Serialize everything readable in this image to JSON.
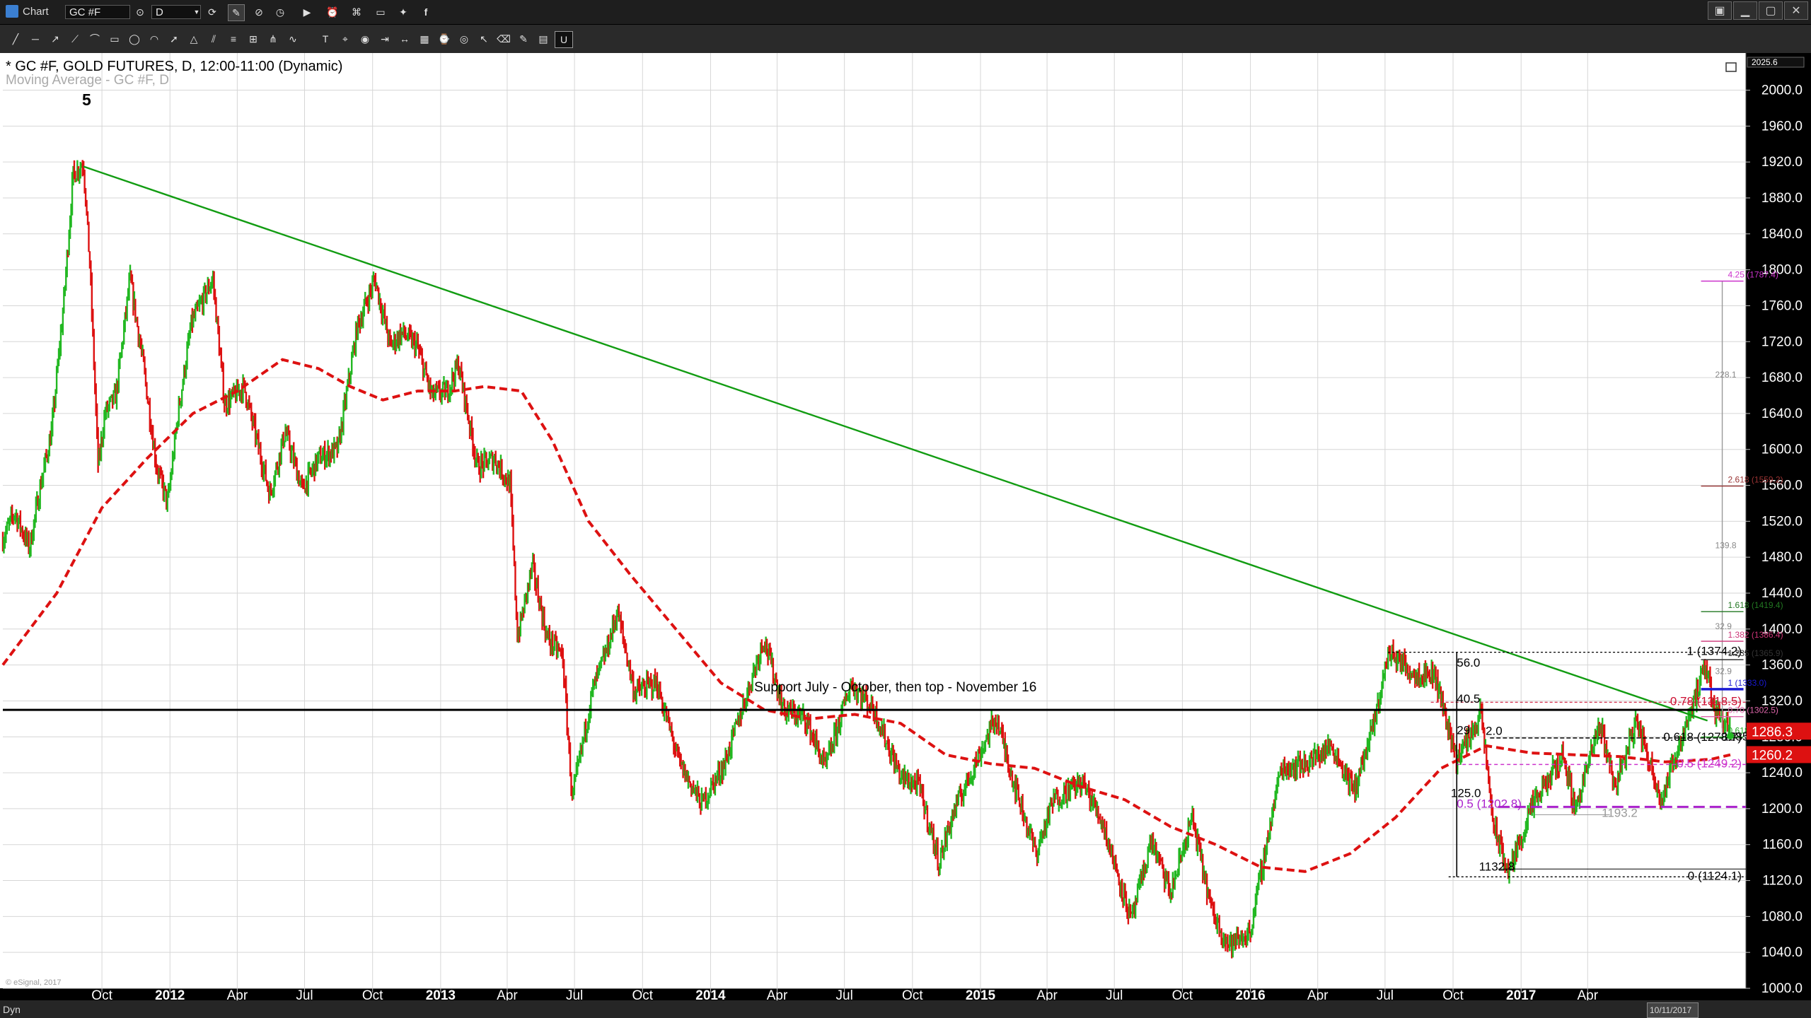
{
  "app": {
    "title": "Chart",
    "symbol": "GC #F",
    "interval": "D",
    "status_left": "Dyn",
    "status_date": "10/11/2017",
    "copyright": "© eSignal, 2017"
  },
  "window_controls": [
    "menu-icon",
    "minimize-icon",
    "restore-icon",
    "close-icon"
  ],
  "toolbar": {
    "top_icons": [
      "link-icon",
      "pencil-icon",
      "clock-icon",
      "play-icon",
      "alarm-icon",
      "tag-icon",
      "comment-icon",
      "twitter-icon",
      "facebook-icon"
    ],
    "drawing_tools": [
      "line-tool",
      "hline-tool",
      "ray-tool",
      "trend-tool",
      "poly-tool",
      "rect-tool",
      "ellipse-tool",
      "arc-tool",
      "arrow-tool",
      "triangle-tool",
      "channel-tool",
      "fib-tool",
      "gann-tool",
      "pitchfork-tool",
      "cycle-tool",
      "text-tool",
      "label-tool",
      "marker-tool",
      "extend-tool",
      "measure-tool",
      "grid-tool",
      "time-tool",
      "eye-tool",
      "cursor-tool",
      "erase-tool",
      "pencil-tool",
      "brush-tool",
      "magnet-tool"
    ]
  },
  "colors": {
    "up_bar": "#22b822",
    "down_bar": "#dd1111",
    "moving_average": "#dd1111",
    "trendline": "#129c12",
    "axis_background": "#000000",
    "grid": "#d6d6d6"
  },
  "chart_data": {
    "type": "line",
    "title": "* GC #F, GOLD FUTURES, D, 12:00-11:00 (Dynamic)",
    "indicator_label": "Moving Average - GC #F, D",
    "wave_label": "5",
    "price_tag_high": "2025.6",
    "ylim": [
      1000,
      2025.6
    ],
    "y_ticks": [
      2000,
      1960,
      1920,
      1880,
      1840,
      1800,
      1760,
      1720,
      1680,
      1640,
      1600,
      1560,
      1520,
      1480,
      1440,
      1400,
      1360,
      1320,
      1280,
      1240,
      1200,
      1160,
      1120,
      1080,
      1040,
      1000
    ],
    "y_tick_labels": [
      "2000.0",
      "1960.0",
      "1920.0",
      "1880.0",
      "1840.0",
      "1800.0",
      "1760.0",
      "1720.0",
      "1680.0",
      "1640.0",
      "1600.0",
      "1560.0",
      "1520.0",
      "1480.0",
      "1440.0",
      "1400.0",
      "1360.0",
      "1320.0",
      "1280.0",
      "1240.0",
      "1200.0",
      "1160.0",
      "1120.0",
      "1080.0",
      "1040.0",
      "1000.0"
    ],
    "xlim": [
      "2011-05-20",
      "2017-11-01"
    ],
    "x_ticks": [
      {
        "date": "2011-10-01",
        "label": "Oct",
        "bold": false
      },
      {
        "date": "2012-01-01",
        "label": "2012",
        "bold": true
      },
      {
        "date": "2012-04-01",
        "label": "Apr",
        "bold": false
      },
      {
        "date": "2012-07-01",
        "label": "Jul",
        "bold": false
      },
      {
        "date": "2012-10-01",
        "label": "Oct",
        "bold": false
      },
      {
        "date": "2013-01-01",
        "label": "2013",
        "bold": true
      },
      {
        "date": "2013-04-01",
        "label": "Apr",
        "bold": false
      },
      {
        "date": "2013-07-01",
        "label": "Jul",
        "bold": false
      },
      {
        "date": "2013-10-01",
        "label": "Oct",
        "bold": false
      },
      {
        "date": "2014-01-01",
        "label": "2014",
        "bold": true
      },
      {
        "date": "2014-04-01",
        "label": "Apr",
        "bold": false
      },
      {
        "date": "2014-07-01",
        "label": "Jul",
        "bold": false
      },
      {
        "date": "2014-10-01",
        "label": "Oct",
        "bold": false
      },
      {
        "date": "2015-01-01",
        "label": "2015",
        "bold": true
      },
      {
        "date": "2015-04-01",
        "label": "Apr",
        "bold": false
      },
      {
        "date": "2015-07-01",
        "label": "Jul",
        "bold": false
      },
      {
        "date": "2015-10-01",
        "label": "Oct",
        "bold": false
      },
      {
        "date": "2016-01-01",
        "label": "2016",
        "bold": true
      },
      {
        "date": "2016-04-01",
        "label": "Apr",
        "bold": false
      },
      {
        "date": "2016-07-01",
        "label": "Jul",
        "bold": false
      },
      {
        "date": "2016-10-01",
        "label": "Oct",
        "bold": false
      },
      {
        "date": "2017-01-01",
        "label": "2017",
        "bold": true
      },
      {
        "date": "2017-04-01",
        "label": "Apr",
        "bold": false
      }
    ],
    "price_path": [
      [
        "2011-05-20",
        1500
      ],
      [
        "2011-06-05",
        1530
      ],
      [
        "2011-06-25",
        1490
      ],
      [
        "2011-07-10",
        1560
      ],
      [
        "2011-07-25",
        1620
      ],
      [
        "2011-08-10",
        1760
      ],
      [
        "2011-08-23",
        1905
      ],
      [
        "2011-09-06",
        1920
      ],
      [
        "2011-09-15",
        1800
      ],
      [
        "2011-09-26",
        1580
      ],
      [
        "2011-10-05",
        1640
      ],
      [
        "2011-10-20",
        1660
      ],
      [
        "2011-11-08",
        1790
      ],
      [
        "2011-11-25",
        1700
      ],
      [
        "2011-12-14",
        1580
      ],
      [
        "2011-12-29",
        1540
      ],
      [
        "2012-01-12",
        1640
      ],
      [
        "2012-01-30",
        1740
      ],
      [
        "2012-02-28",
        1790
      ],
      [
        "2012-03-15",
        1650
      ],
      [
        "2012-04-10",
        1670
      ],
      [
        "2012-05-15",
        1550
      ],
      [
        "2012-06-05",
        1620
      ],
      [
        "2012-06-28",
        1555
      ],
      [
        "2012-07-20",
        1590
      ],
      [
        "2012-08-15",
        1600
      ],
      [
        "2012-09-10",
        1735
      ],
      [
        "2012-10-04",
        1790
      ],
      [
        "2012-10-25",
        1715
      ],
      [
        "2012-11-10",
        1730
      ],
      [
        "2012-11-30",
        1715
      ],
      [
        "2012-12-20",
        1660
      ],
      [
        "2013-01-10",
        1665
      ],
      [
        "2013-01-25",
        1695
      ],
      [
        "2013-02-20",
        1580
      ],
      [
        "2013-03-15",
        1590
      ],
      [
        "2013-04-05",
        1560
      ],
      [
        "2013-04-15",
        1390
      ],
      [
        "2013-05-05",
        1470
      ],
      [
        "2013-05-25",
        1390
      ],
      [
        "2013-06-15",
        1370
      ],
      [
        "2013-06-28",
        1210
      ],
      [
        "2013-07-25",
        1330
      ],
      [
        "2013-08-15",
        1380
      ],
      [
        "2013-08-28",
        1420
      ],
      [
        "2013-09-20",
        1330
      ],
      [
        "2013-10-20",
        1340
      ],
      [
        "2013-11-20",
        1250
      ],
      [
        "2013-12-20",
        1205
      ],
      [
        "2014-01-20",
        1250
      ],
      [
        "2014-02-20",
        1330
      ],
      [
        "2014-03-14",
        1390
      ],
      [
        "2014-04-10",
        1310
      ],
      [
        "2014-05-10",
        1300
      ],
      [
        "2014-06-05",
        1245
      ],
      [
        "2014-07-10",
        1340
      ],
      [
        "2014-08-10",
        1310
      ],
      [
        "2014-09-15",
        1235
      ],
      [
        "2014-10-10",
        1225
      ],
      [
        "2014-11-06",
        1140
      ],
      [
        "2014-11-25",
        1195
      ],
      [
        "2015-01-22",
        1302
      ],
      [
        "2015-02-15",
        1230
      ],
      [
        "2015-03-17",
        1150
      ],
      [
        "2015-04-10",
        1210
      ],
      [
        "2015-05-18",
        1230
      ],
      [
        "2015-06-15",
        1185
      ],
      [
        "2015-07-24",
        1075
      ],
      [
        "2015-08-20",
        1165
      ],
      [
        "2015-09-15",
        1105
      ],
      [
        "2015-10-14",
        1190
      ],
      [
        "2015-11-10",
        1085
      ],
      [
        "2015-12-03",
        1048
      ],
      [
        "2015-12-31",
        1061
      ],
      [
        "2016-02-11",
        1245
      ],
      [
        "2016-03-15",
        1250
      ],
      [
        "2016-04-20",
        1270
      ],
      [
        "2016-05-20",
        1220
      ],
      [
        "2016-06-15",
        1290
      ],
      [
        "2016-07-06",
        1375
      ],
      [
        "2016-08-10",
        1350
      ],
      [
        "2016-09-06",
        1350
      ],
      [
        "2016-10-06",
        1255
      ],
      [
        "2016-11-08",
        1305
      ],
      [
        "2016-11-25",
        1180
      ],
      [
        "2016-12-15",
        1128
      ],
      [
        "2017-01-15",
        1200
      ],
      [
        "2017-02-27",
        1260
      ],
      [
        "2017-03-15",
        1200
      ],
      [
        "2017-04-18",
        1295
      ],
      [
        "2017-05-08",
        1225
      ],
      [
        "2017-06-06",
        1298
      ],
      [
        "2017-07-10",
        1210
      ],
      [
        "2017-08-10",
        1290
      ],
      [
        "2017-09-08",
        1358
      ],
      [
        "2017-09-20",
        1310
      ],
      [
        "2017-10-11",
        1293
      ]
    ],
    "moving_average": [
      [
        "2011-05-20",
        1360
      ],
      [
        "2011-08-01",
        1440
      ],
      [
        "2011-10-01",
        1535
      ],
      [
        "2011-12-01",
        1590
      ],
      [
        "2012-02-01",
        1640
      ],
      [
        "2012-04-01",
        1665
      ],
      [
        "2012-06-01",
        1700
      ],
      [
        "2012-07-20",
        1690
      ],
      [
        "2012-09-01",
        1670
      ],
      [
        "2012-10-15",
        1655
      ],
      [
        "2012-12-01",
        1665
      ],
      [
        "2013-01-20",
        1665
      ],
      [
        "2013-03-01",
        1670
      ],
      [
        "2013-04-20",
        1665
      ],
      [
        "2013-06-01",
        1610
      ],
      [
        "2013-07-20",
        1520
      ],
      [
        "2013-09-15",
        1460
      ],
      [
        "2013-11-15",
        1400
      ],
      [
        "2014-01-15",
        1340
      ],
      [
        "2014-03-15",
        1310
      ],
      [
        "2014-05-15",
        1300
      ],
      [
        "2014-07-15",
        1305
      ],
      [
        "2014-09-15",
        1295
      ],
      [
        "2014-11-15",
        1260
      ],
      [
        "2015-01-15",
        1250
      ],
      [
        "2015-03-15",
        1245
      ],
      [
        "2015-05-15",
        1225
      ],
      [
        "2015-07-15",
        1210
      ],
      [
        "2015-09-15",
        1180
      ],
      [
        "2015-11-15",
        1160
      ],
      [
        "2016-01-15",
        1135
      ],
      [
        "2016-03-15",
        1130
      ],
      [
        "2016-05-15",
        1150
      ],
      [
        "2016-07-15",
        1190
      ],
      [
        "2016-09-15",
        1245
      ],
      [
        "2016-11-15",
        1270
      ],
      [
        "2017-01-15",
        1262
      ],
      [
        "2017-03-15",
        1260
      ],
      [
        "2017-05-15",
        1258
      ],
      [
        "2017-07-15",
        1252
      ],
      [
        "2017-09-15",
        1255
      ],
      [
        "2017-10-11",
        1260
      ]
    ],
    "trendline": {
      "from": [
        "2011-09-06",
        1915
      ],
      "to": [
        "2017-09-10",
        1298
      ]
    },
    "support_line": {
      "value": 1310,
      "label": "Support July - October, then top - November 16",
      "label_date": "2014-03-01"
    },
    "hlines": [
      {
        "value": 1374.2,
        "from": "2016-07-05",
        "to": "2017-11-01",
        "color": "#000000",
        "dash": "3,3",
        "width": 1.3
      },
      {
        "value": 1318.5,
        "from": "2016-09-01",
        "to": "2017-11-01",
        "color": "#cc1133",
        "dash": "4,3",
        "width": 1.1
      },
      {
        "value": 1278.7,
        "from": "2016-11-20",
        "to": "2017-11-01",
        "color": "#000000",
        "dash": "6,3",
        "width": 1.5
      },
      {
        "value": 1249.2,
        "from": "2016-10-05",
        "to": "2017-11-01",
        "color": "#cc33cc",
        "dash": "5,4",
        "width": 1.5
      },
      {
        "value": 1202.0,
        "from": "2016-12-01",
        "to": "2017-11-01",
        "color": "#aa22cc",
        "dash": "16,7",
        "width": 3
      },
      {
        "value": 1132.8,
        "from": "2016-12-01",
        "to": "2017-11-01",
        "color": "#000000",
        "dash": "",
        "width": 1
      },
      {
        "value": 1124.1,
        "from": "2016-09-25",
        "to": "2017-11-01",
        "color": "#000000",
        "dash": "3,3",
        "width": 1.3
      },
      {
        "value": 1193.2,
        "from": "2017-01-20",
        "to": "2017-05-01",
        "color": "#999999",
        "dash": "",
        "width": 1
      },
      {
        "value": 1365.9,
        "from": "2017-09-10",
        "to": "2017-10-20",
        "color": "#333333",
        "dash": "",
        "width": 1
      }
    ],
    "ext_levels": [
      {
        "value": 1787.4,
        "label": "4.25 (1787.4)",
        "color": "#cc33cc"
      },
      {
        "value": 1559.2,
        "label": "2.618 (1559.2)",
        "color": "#993333"
      },
      {
        "value": 1419.4,
        "label": "1.618 (1419.4)",
        "color": "#227722"
      },
      {
        "value": 1386.4,
        "label": "1.382 (1386.4)",
        "color": "#cc3377"
      },
      {
        "value": 1365.9,
        "label": "1.235 (1365.9)",
        "color": "#333333"
      },
      {
        "value": 1333.0,
        "label": "1 (1333.0)",
        "color": "#1a1ad4"
      },
      {
        "value": 1302.5,
        "label": "0.70 (1302.5)",
        "color": "#dd66aa"
      },
      {
        "value": 1279.8,
        "label": "0.618 (1279.8)",
        "color": "#22aa22"
      }
    ],
    "ext_stats": [
      {
        "value": 1680,
        "label": "228.1"
      },
      {
        "value": 1490,
        "label": "139.8"
      },
      {
        "value": 1400,
        "label": "32.9"
      },
      {
        "value": 1350,
        "label": "32.9"
      }
    ],
    "level_labels": [
      {
        "value": 1374.2,
        "label": "1 (1374.2)",
        "color": "#000000"
      },
      {
        "value": 1318.5,
        "label": "0.78 (1318.5)",
        "color": "#cc1133"
      },
      {
        "value": 1278.7,
        "label": "0.618 (1278.7)",
        "color": "#000000"
      },
      {
        "value": 1249.2,
        "label": "0.5 (1249.2)",
        "color": "#cc33cc"
      },
      {
        "value": 1124.1,
        "label": "0 (1124.1)",
        "color": "#000000"
      }
    ],
    "inner_labels": [
      {
        "date": "2016-10-06",
        "value": 1358,
        "label": "56.0",
        "color": "#000000"
      },
      {
        "date": "2016-10-06",
        "value": 1318,
        "label": "40.5",
        "color": "#000000"
      },
      {
        "date": "2016-10-06",
        "value": 1283,
        "label": "29",
        "color": "#000000"
      },
      {
        "date": "2016-11-14",
        "value": 1282,
        "label": "2.0",
        "color": "#000000"
      },
      {
        "date": "2016-09-28",
        "value": 1213,
        "label": "125.0",
        "color": "#000000"
      },
      {
        "date": "2016-10-06",
        "value": 1201,
        "label": "0.5 (1202.8)",
        "color": "#aa22cc"
      },
      {
        "date": "2016-11-05",
        "value": 1131,
        "label": "1132.8",
        "color": "#000000"
      },
      {
        "date": "2017-04-20",
        "value": 1191,
        "label": "1193.2",
        "color": "#999999"
      },
      {
        "date": "2017-09-30",
        "value": 1276,
        "label": "1285.6",
        "color": "#000000"
      }
    ],
    "price_tags": [
      {
        "value": 1286.3,
        "label": "1286.3",
        "bg": "#dd1111"
      },
      {
        "value": 1260.2,
        "label": "1260.2",
        "bg": "#dd1111"
      }
    ]
  }
}
